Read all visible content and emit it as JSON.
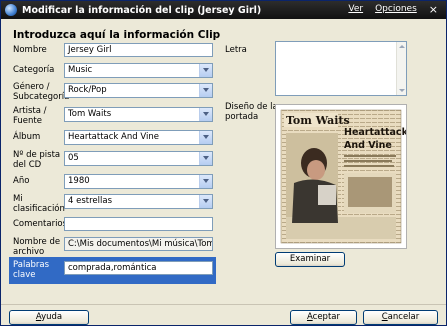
{
  "window": {
    "title": "Modificar la información del clip (Jersey Girl)",
    "menu": {
      "ver": "Ver",
      "opciones": "Opciones",
      "close": "×"
    }
  },
  "form": {
    "heading": "Introduzca aquí la información Clip",
    "nombre": {
      "label": "Nombre",
      "value": "Jersey Girl"
    },
    "categoria": {
      "label": "Categoría",
      "value": "Music"
    },
    "genero": {
      "label_line1": "Género /",
      "label_line2": "Subcategoría",
      "value": "Rock/Pop"
    },
    "artista": {
      "label_line1": "Artista /",
      "label_line2": "Fuente",
      "value": "Tom Waits"
    },
    "album": {
      "label": "Álbum",
      "value": "Heartattack And Vine"
    },
    "pista": {
      "label_line1": "Nº de pista",
      "label_line2": "del CD",
      "value": "05"
    },
    "ano": {
      "label": "Año",
      "value": "1980"
    },
    "clasificacion": {
      "label_line1": "Mi",
      "label_line2": "clasificación",
      "value": "4 estrellas"
    },
    "comentarios": {
      "label": "Comentarios",
      "value": ""
    },
    "archivo": {
      "label_line1": "Nombre de",
      "label_line2": "archivo",
      "value": "C:\\Mis documentos\\Mi música\\Tom Wa"
    },
    "palabras": {
      "label_line1": "Palabras",
      "label_line2": "clave",
      "value": "comprada,romántica"
    }
  },
  "right": {
    "letra_label": "Letra",
    "letra_value": "",
    "cover_label_line1": "Diseño de la",
    "cover_label_line2": "portada",
    "cover": {
      "artist": "Tom Waits",
      "album_line1": "Heartattack",
      "album_line2": "And Vine"
    },
    "examinar": "Examinar"
  },
  "footer": {
    "ayuda_u": "A",
    "ayuda_rest": "yuda",
    "aceptar_u": "A",
    "aceptar_rest": "ceptar",
    "cancelar_u": "C",
    "cancelar_rest": "ancelar"
  }
}
